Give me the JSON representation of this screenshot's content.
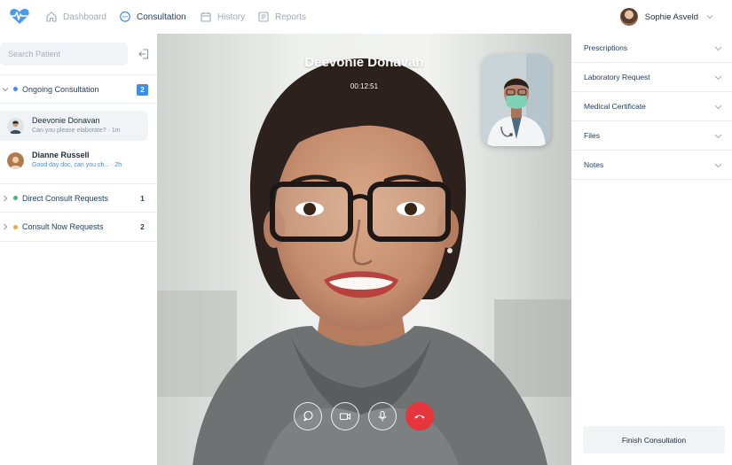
{
  "nav": {
    "items": [
      {
        "label": "Dashboard",
        "icon": "home-icon",
        "active": false
      },
      {
        "label": "Consultation",
        "icon": "chat-bubble-icon",
        "active": true
      },
      {
        "label": "History",
        "icon": "history-icon",
        "active": false
      },
      {
        "label": "Reports",
        "icon": "reports-icon",
        "active": false
      }
    ],
    "user_name": "Sophie Asveld"
  },
  "sidebar": {
    "search_placeholder": "Search Patient",
    "ongoing": {
      "label": "Ongoing Consultation",
      "count": "2"
    },
    "chats": [
      {
        "name": "Deevonie Donavan",
        "message": "Can you please elaborate? · 1m",
        "selected": true
      },
      {
        "name": "Dianne Russell",
        "message": "Good day doc, can you ch... · 2h",
        "selected": false
      }
    ],
    "direct": {
      "label": "Direct Consult Requests",
      "count": "1"
    },
    "consult_now": {
      "label": "Consult Now Requests",
      "count": "2"
    }
  },
  "call": {
    "patient_name": "Deevonie Donavan",
    "timer": "00:12:51",
    "controls": [
      "chat-icon",
      "video-camera-icon",
      "microphone-icon",
      "end-call-icon"
    ]
  },
  "right_panel": {
    "sections": [
      "Prescriptions",
      "Laboratory Request",
      "Medical Certificate",
      "Files",
      "Notes"
    ],
    "finish_label": "Finish Consultation"
  },
  "colors": {
    "accent": "#3d8ee8",
    "navy": "#1e3a5c",
    "end_call": "#e5363d",
    "green_dot": "#3bbf6a",
    "orange_dot": "#f2a93b"
  }
}
